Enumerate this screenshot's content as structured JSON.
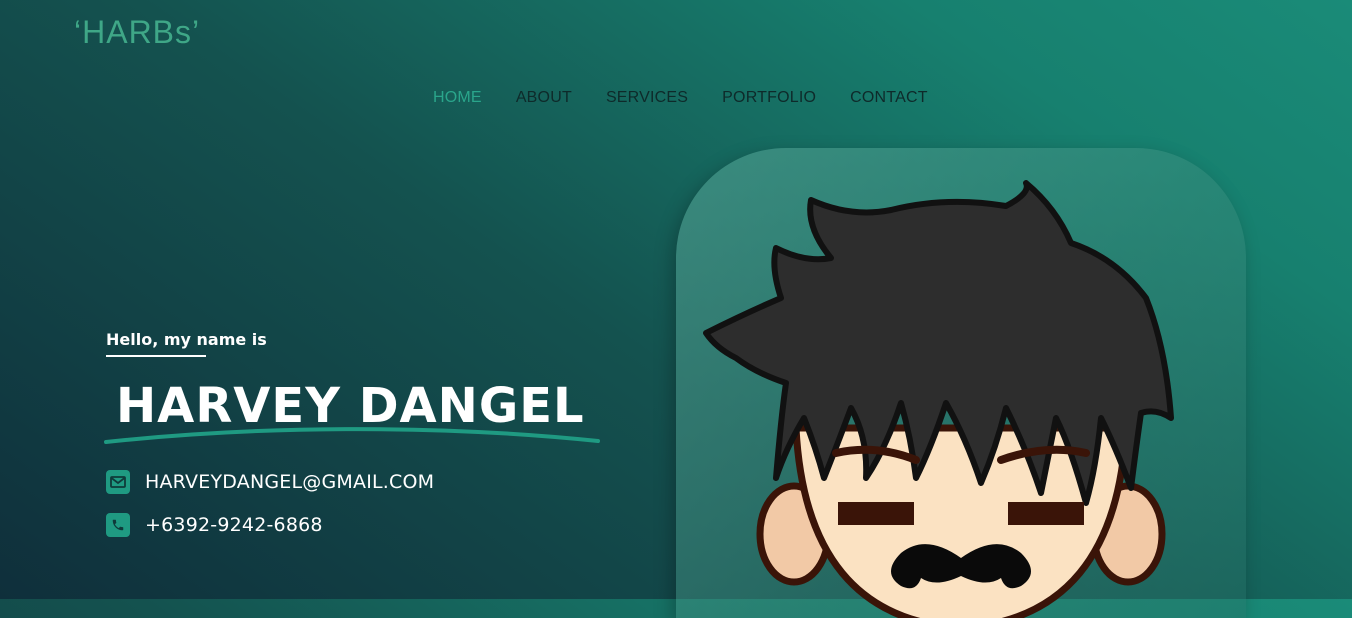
{
  "brand": {
    "logo_text": "‘HARBs’"
  },
  "nav": {
    "items": [
      {
        "label": "HOME",
        "active": true
      },
      {
        "label": "ABOUT"
      },
      {
        "label": "SERVICES"
      },
      {
        "label": "PORTFOLIO"
      },
      {
        "label": "CONTACT"
      }
    ]
  },
  "hero": {
    "greeting": "Hello, my name is",
    "name": "HARVEY DANGEL",
    "email": "HARVEYDANGEL@GMAIL.COM",
    "phone": "+6392-9242-6868",
    "icons": {
      "email": "envelope-icon",
      "phone": "phone-icon"
    }
  },
  "colors": {
    "accent": "#2aa58b",
    "logo": "#3fa787",
    "nav_text": "#0e2a2a",
    "text_light": "#ffffff",
    "icon_bg": "#1f9a82"
  }
}
